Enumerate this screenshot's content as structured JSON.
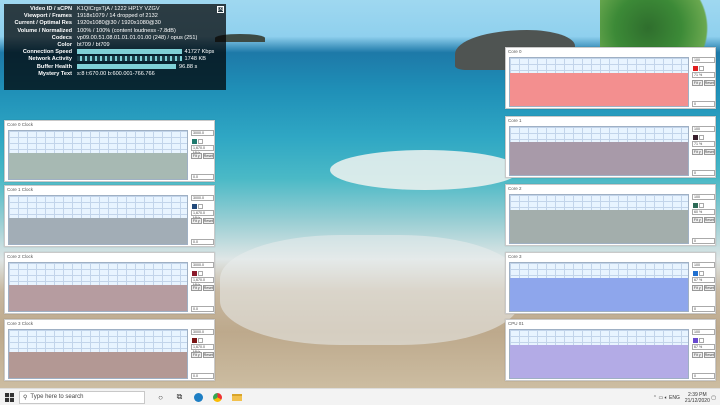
{
  "stats": {
    "close_label": "[x]",
    "rows": [
      {
        "label": "Video ID / sCPN",
        "value": "K1QICrgxTjA / 1222 HP1Y VZGV"
      },
      {
        "label": "Viewport / Frames",
        "value": "1918x1079 / 14 dropped of 2132"
      },
      {
        "label": "Current / Optimal Res",
        "value": "1920x1080@30 / 1920x1080@30"
      },
      {
        "label": "Volume / Normalized",
        "value": "100% / 100% (content loudness -7.8dB)"
      },
      {
        "label": "Codecs",
        "value": "vp09.00.51.08.01.01.01.01.00 (248) / opus (251)"
      },
      {
        "label": "Color",
        "value": "bt709 / bt709"
      },
      {
        "label": "Connection Speed",
        "value": "41727 Kbps"
      },
      {
        "label": "Network Activity",
        "value": "1748 KB"
      },
      {
        "label": "Buffer Health",
        "value": "96.88 s"
      },
      {
        "label": "Mystery Text",
        "value": "s:8 t:670.00 b:600.001-766.766"
      }
    ],
    "connection_speed_fraction": 0.95,
    "network_activity_fraction": 0.95,
    "buffer_health_fraction": 0.9
  },
  "graphs_left": [
    {
      "title": "Core 0 Clock",
      "scale": "3000.0",
      "readout": "1,670.0 MHz",
      "fit_label": "Fit y",
      "reset_label": "Reset",
      "value": "0.0",
      "color": "#a7b9b3",
      "swatch": "#1f7a6e",
      "level": 0.55
    },
    {
      "title": "Core 1 Clock",
      "scale": "3000.0",
      "readout": "1,670.0 MHz",
      "fit_label": "Fit y",
      "reset_label": "Reset",
      "value": "0.0",
      "color": "#a2adb6",
      "swatch": "#234a7a",
      "level": 0.55
    },
    {
      "title": "Core 2 Clock",
      "scale": "3000.0",
      "readout": "1,670.0 MHz",
      "fit_label": "Fit y",
      "reset_label": "Reset",
      "value": "0.0",
      "color": "#b69ca0",
      "swatch": "#8a1a2a",
      "level": 0.55
    },
    {
      "title": "Core 3 Clock",
      "scale": "3000.0",
      "readout": "1,670.0 MHz",
      "fit_label": "Fit y",
      "reset_label": "Reset",
      "value": "0.0",
      "color": "#b39894",
      "swatch": "#7a1414",
      "level": 0.55
    }
  ],
  "graphs_right": [
    {
      "title": "Core 0",
      "scale": "100",
      "readout": "71 %",
      "fit_label": "Fit y",
      "reset_label": "Reset",
      "value": "0",
      "color": "#f38f8f",
      "swatch": "#e01e1e",
      "level": 0.68
    },
    {
      "title": "Core 1",
      "scale": "100",
      "readout": "71 %",
      "fit_label": "Fit y",
      "reset_label": "Reset",
      "value": "0",
      "color": "#a89aa9",
      "swatch": "#3a1f2d",
      "level": 0.68
    },
    {
      "title": "Core 2",
      "scale": "100",
      "readout": "60 %",
      "fit_label": "Fit y",
      "reset_label": "Reset",
      "value": "0",
      "color": "#a3aeac",
      "swatch": "#2c6a56",
      "level": 0.68
    },
    {
      "title": "Core 3",
      "scale": "100",
      "readout": "67 %",
      "fit_label": "Fit y",
      "reset_label": "Reset",
      "value": "0",
      "color": "#8ea6ec",
      "swatch": "#1f6fd0",
      "level": 0.68
    },
    {
      "title": "CPU 01",
      "scale": "100",
      "readout": "67 %",
      "fit_label": "Fit y",
      "reset_label": "Reset",
      "value": "0",
      "color": "#b3abe6",
      "swatch": "#6a4ad0",
      "level": 0.68
    }
  ],
  "taskbar": {
    "search_placeholder": "Type here to search",
    "language": "ENG",
    "time": "2:39 PM",
    "date": "21/12/2020"
  }
}
